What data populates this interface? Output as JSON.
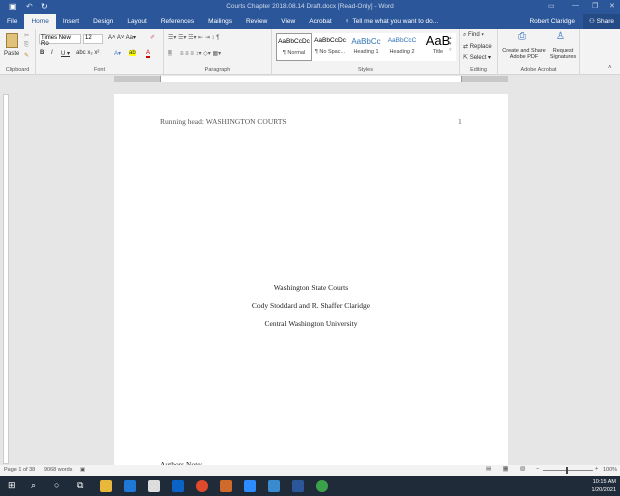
{
  "window": {
    "title": "Courts Chapter 2018.08.14 Draft.docx [Read-Only] - Word"
  },
  "tabs": [
    "File",
    "Home",
    "Insert",
    "Design",
    "Layout",
    "References",
    "Mailings",
    "Review",
    "View",
    "Acrobat"
  ],
  "tell_me": "Tell me what you want to do...",
  "user": "Robert Claridge",
  "share": "Share",
  "ribbon": {
    "clipboard": {
      "label": "Clipboard",
      "paste": "Paste"
    },
    "font": {
      "label": "Font",
      "name": "Times New Ro",
      "size": "12"
    },
    "paragraph": {
      "label": "Paragraph"
    },
    "styles": {
      "label": "Styles",
      "items": [
        {
          "sample": "AaBbCcDc",
          "name": "¶ Normal"
        },
        {
          "sample": "AaBbCcDc",
          "name": "¶ No Spac..."
        },
        {
          "sample": "AaBbCc",
          "name": "Heading 1"
        },
        {
          "sample": "AaBbCcC",
          "name": "Heading 2"
        },
        {
          "sample": "AaB",
          "name": "Title"
        }
      ]
    },
    "editing": {
      "label": "Editing",
      "find": "Find",
      "replace": "Replace",
      "select": "Select"
    },
    "acrobat": {
      "label": "Adobe Acrobat",
      "create": "Create and Share Adobe PDF",
      "request": "Request Signatures"
    }
  },
  "document": {
    "header": "Running head: WASHINGTON COURTS",
    "page_number": "1",
    "title": "Washington State Courts",
    "authors": "Cody Stoddard and R. Shaffer Claridge",
    "affiliation": "Central Washington University",
    "note": "Authors Note:"
  },
  "status": {
    "page": "Page 1 of 38",
    "words": "9068 words",
    "zoom": "100%",
    "zoom_level": 100
  },
  "taskbar": {
    "time": "10:15 AM",
    "date": "1/20/2021"
  },
  "colors": {
    "accent": "#2b579a"
  }
}
